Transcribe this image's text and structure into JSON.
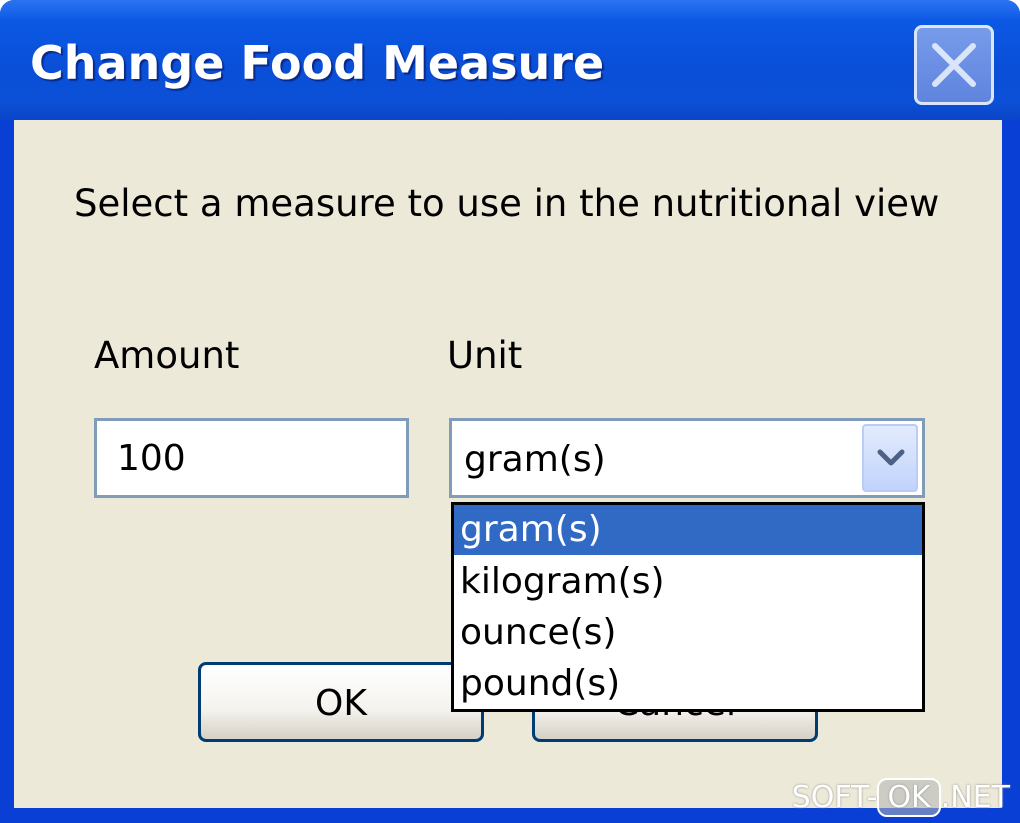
{
  "window": {
    "title": "Change Food Measure",
    "close_icon": "close-icon"
  },
  "dialog": {
    "prompt": "Select a measure to use in the nutritional view",
    "amount_label": "Amount",
    "amount_value": "100",
    "unit_label": "Unit",
    "unit_selected": "gram(s)",
    "unit_options": [
      "gram(s)",
      "kilogram(s)",
      "ounce(s)",
      "pound(s)"
    ],
    "ok_label": "OK",
    "cancel_label": "Cancel"
  },
  "watermark": {
    "left": "SOFT-",
    "box": "OK",
    "right": ".NET"
  },
  "colors": {
    "titlebar": "#0a4fd8",
    "client_bg": "#ece9d8",
    "selection": "#316ac5"
  }
}
